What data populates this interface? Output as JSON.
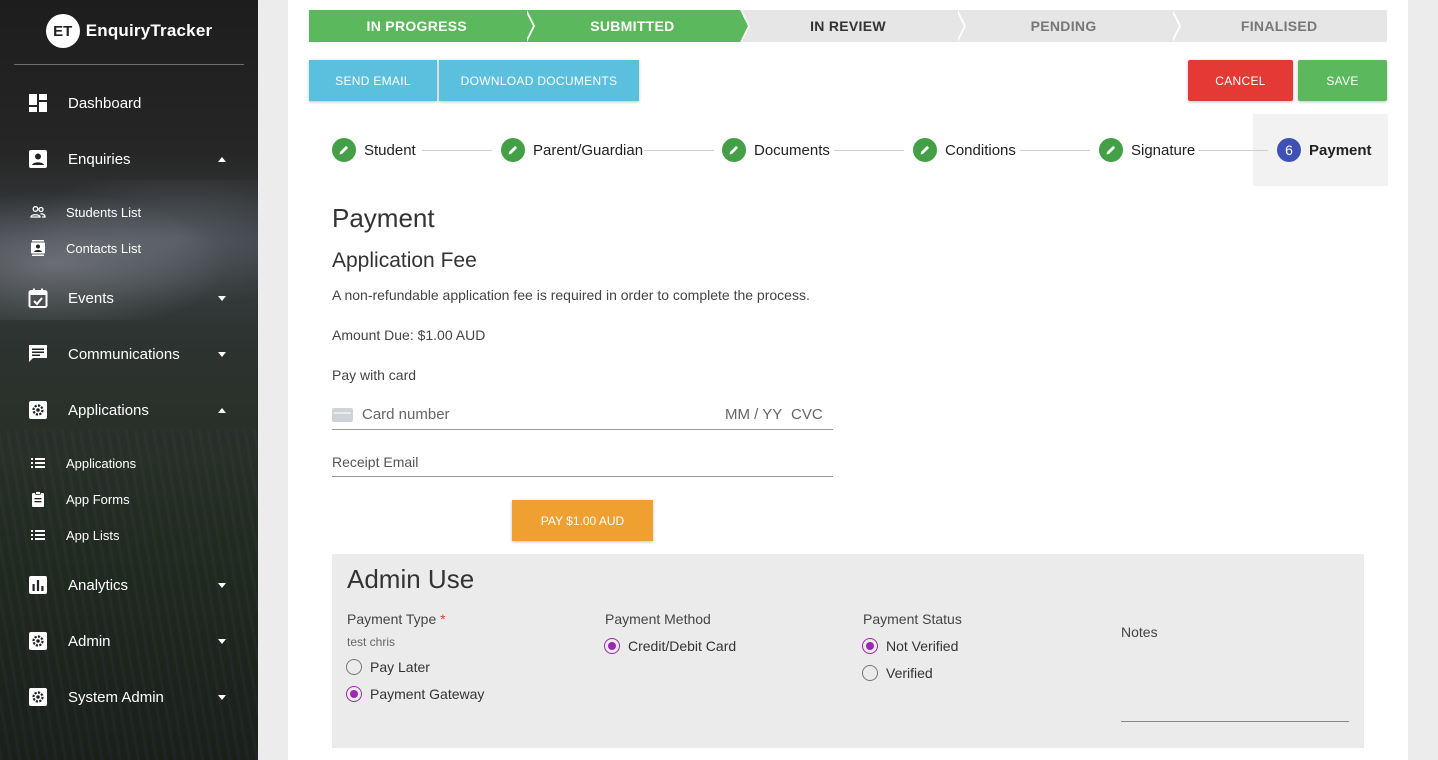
{
  "app": {
    "logo_badge": "ET",
    "logo_text": "EnquiryTracker"
  },
  "sidebar": {
    "items": [
      {
        "label": "Dashboard",
        "icon": "dashboard-icon"
      },
      {
        "label": "Enquiries",
        "icon": "account-box-icon",
        "expanded": true
      },
      {
        "label": "Events",
        "icon": "event-icon",
        "expanded": false
      },
      {
        "label": "Communications",
        "icon": "message-icon",
        "expanded": false
      },
      {
        "label": "Applications",
        "icon": "settings-box-icon",
        "expanded": true
      },
      {
        "label": "Analytics",
        "icon": "chart-icon",
        "expanded": false
      },
      {
        "label": "Admin",
        "icon": "settings-box-icon",
        "expanded": false
      },
      {
        "label": "System Admin",
        "icon": "settings-box-icon",
        "expanded": false
      }
    ],
    "enquiries_sub": [
      {
        "label": "Students List",
        "icon": "people-icon"
      },
      {
        "label": "Contacts List",
        "icon": "contacts-icon"
      }
    ],
    "applications_sub": [
      {
        "label": "Applications",
        "icon": "list-icon"
      },
      {
        "label": "App Forms",
        "icon": "clipboard-icon"
      },
      {
        "label": "App Lists",
        "icon": "list-icon"
      }
    ]
  },
  "status_steps": [
    {
      "label": "IN PROGRESS",
      "state": "done"
    },
    {
      "label": "SUBMITTED",
      "state": "done"
    },
    {
      "label": "IN REVIEW",
      "state": "current"
    },
    {
      "label": "PENDING",
      "state": "todo"
    },
    {
      "label": "FINALISED",
      "state": "todo"
    }
  ],
  "actions": {
    "send_email": "SEND EMAIL",
    "download_documents": "DOWNLOAD DOCUMENTS",
    "cancel": "CANCEL",
    "save": "SAVE"
  },
  "stepper": [
    {
      "label": "Student",
      "state": "complete"
    },
    {
      "label": "Parent/Guardian",
      "state": "complete"
    },
    {
      "label": "Documents",
      "state": "complete"
    },
    {
      "label": "Conditions",
      "state": "complete"
    },
    {
      "label": "Signature",
      "state": "complete"
    },
    {
      "label": "Payment",
      "state": "active",
      "number": "6"
    }
  ],
  "payment": {
    "heading": "Payment",
    "subheading": "Application Fee",
    "description": "A non-refundable application fee is required in order to complete the process.",
    "amount_due": "Amount Due: $1.00 AUD",
    "pay_with_card": "Pay with card",
    "card_number_placeholder": "Card number",
    "expiry_placeholder": "MM / YY",
    "cvc_placeholder": "CVC",
    "receipt_email_placeholder": "Receipt Email",
    "pay_button": "PAY $1.00 AUD"
  },
  "admin": {
    "title": "Admin Use",
    "payment_type": {
      "label": "Payment Type",
      "required_mark": "*",
      "helper": "test chris",
      "options": [
        {
          "label": "Pay Later",
          "selected": false
        },
        {
          "label": "Payment Gateway",
          "selected": true
        }
      ]
    },
    "payment_method": {
      "label": "Payment Method",
      "options": [
        {
          "label": "Credit/Debit Card",
          "selected": true
        }
      ]
    },
    "payment_status": {
      "label": "Payment Status",
      "options": [
        {
          "label": "Not Verified",
          "selected": true
        },
        {
          "label": "Verified",
          "selected": false
        }
      ]
    },
    "notes": {
      "label": "Notes"
    }
  },
  "colors": {
    "green": "#5cb85c",
    "blue": "#5bc0de",
    "red": "#e53935",
    "orange": "#f0a030",
    "indigo": "#3f51b5",
    "purple": "#9c27b0"
  }
}
